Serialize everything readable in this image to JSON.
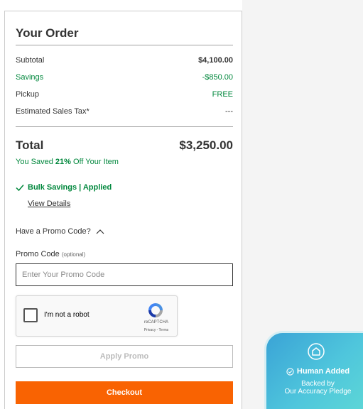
{
  "order": {
    "title": "Your Order",
    "subtotal_label": "Subtotal",
    "subtotal_value": "$4,100.00",
    "savings_label": "Savings",
    "savings_value": "-$850.00",
    "pickup_label": "Pickup",
    "pickup_value": "FREE",
    "tax_label": "Estimated Sales Tax*",
    "tax_value": "---",
    "total_label": "Total",
    "total_value": "$3,250.00",
    "saved_prefix": "You Saved ",
    "saved_percent": "21%",
    "saved_suffix": " Off Your Item",
    "bulk_label": "Bulk Savings | Applied",
    "view_details": "View Details"
  },
  "promo": {
    "question": "Have a Promo Code?",
    "label": "Promo Code",
    "label_optional": "(optional)",
    "placeholder": "Enter Your Promo Code",
    "apply_label": "Apply Promo"
  },
  "captcha": {
    "label": "I'm not a robot",
    "brand": "reCAPTCHA",
    "links": "Privacy - Terms"
  },
  "checkout_label": "Checkout",
  "badge": {
    "title": "Human Added",
    "line1": "Backed by",
    "line2": "Our Accuracy Pledge"
  },
  "colors": {
    "accent_orange": "#f96302",
    "savings_green": "#00873c",
    "badge_blue": "#3aa3d6"
  }
}
